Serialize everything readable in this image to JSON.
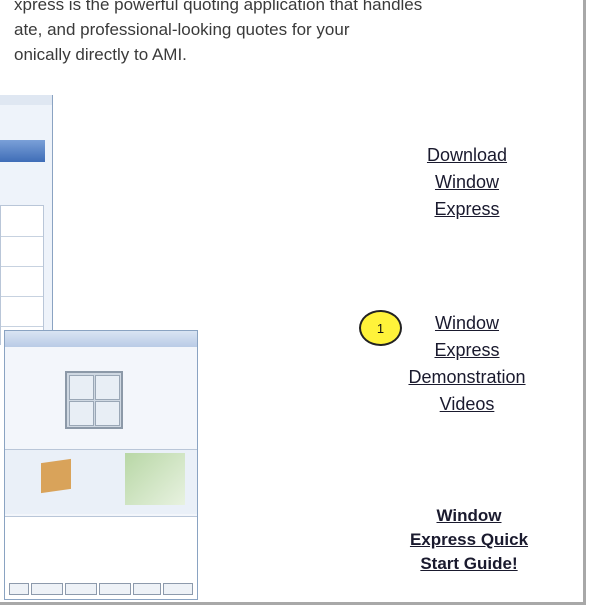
{
  "intro": {
    "line1": "xpress is the powerful quoting application that handles",
    "line2": "ate, and professional-looking quotes for your",
    "line3": "onically directly to AMI."
  },
  "links": {
    "download": [
      "Download",
      "Window",
      "Express"
    ],
    "videos": [
      "Window",
      "Express",
      "Demonstration",
      "Videos"
    ],
    "guide": [
      "Window",
      "Express Quick",
      "Start Guide!"
    ]
  },
  "marker": "1",
  "colors": {
    "marker_fill": "#fff33a",
    "link_text": "#1a1a2e"
  }
}
